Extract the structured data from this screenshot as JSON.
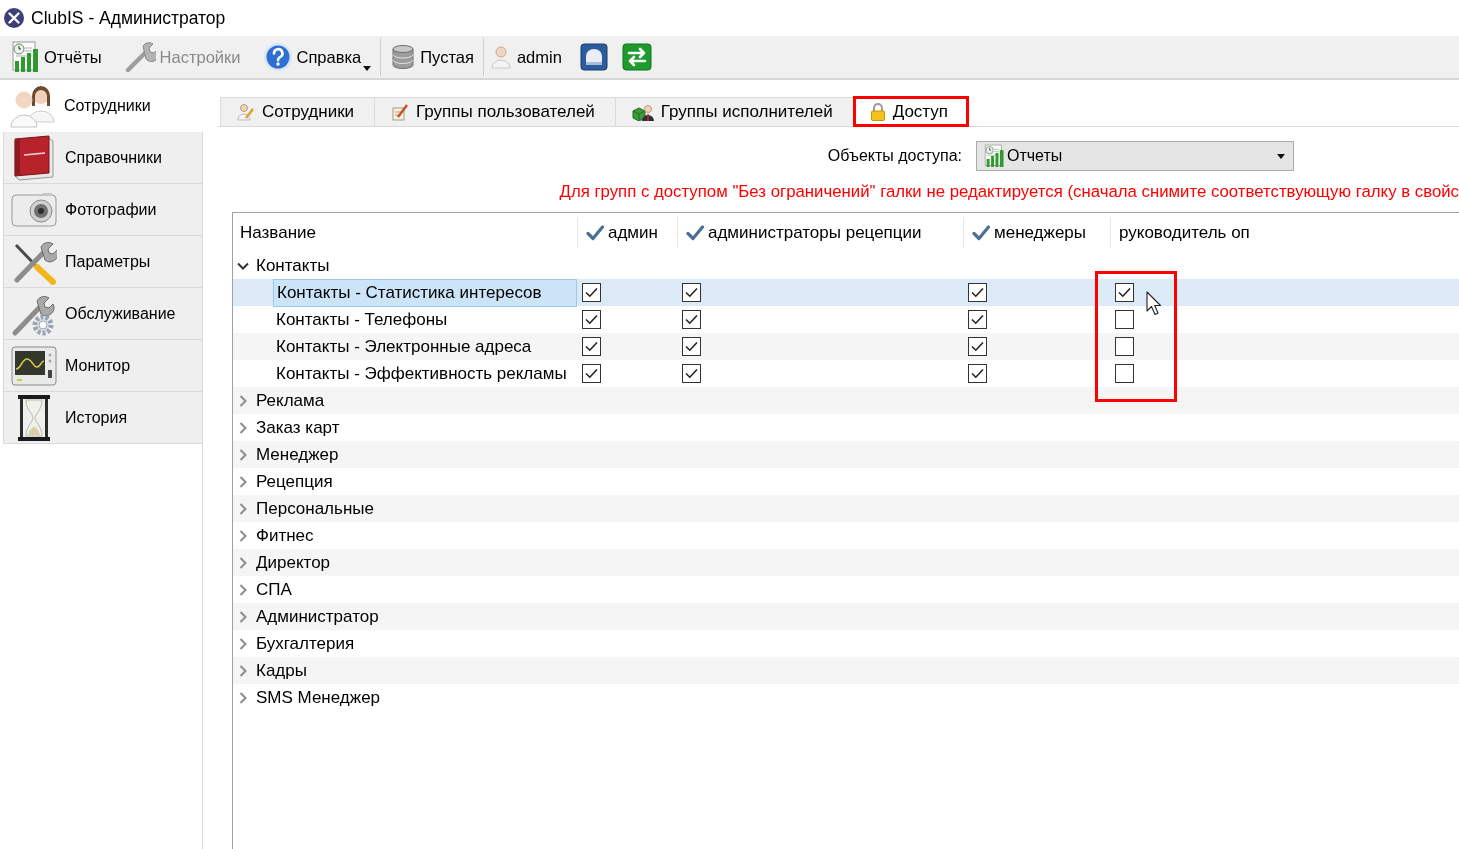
{
  "window": {
    "title": "ClubIS - Администратор"
  },
  "toolbar": {
    "groups": [
      [
        {
          "kind": "button",
          "label": "Отчёты",
          "disabled": false,
          "dropdown": false
        },
        {
          "kind": "button",
          "label": "Настройки",
          "disabled": true,
          "dropdown": false
        },
        {
          "kind": "button",
          "label": "Справка",
          "disabled": false,
          "dropdown": true
        }
      ],
      [
        {
          "kind": "button",
          "label": "Пустая",
          "disabled": false,
          "dropdown": false
        }
      ],
      [
        {
          "kind": "user",
          "label": "admin"
        },
        {
          "kind": "icon_button",
          "disabled": false
        },
        {
          "kind": "icon_button",
          "disabled": false
        }
      ]
    ]
  },
  "sidebar": {
    "items": [
      {
        "label": "Сотрудники",
        "selected": true
      },
      {
        "label": "Справочники",
        "selected": false
      },
      {
        "label": "Фотографии",
        "selected": false
      },
      {
        "label": "Параметры",
        "selected": false
      },
      {
        "label": "Обслуживание",
        "selected": false
      },
      {
        "label": "Монитор",
        "selected": false
      },
      {
        "label": "История",
        "selected": false
      }
    ]
  },
  "tabs": [
    {
      "label": "Сотрудники",
      "selected": false,
      "highlighted": false
    },
    {
      "label": "Группы пользователей",
      "selected": false,
      "highlighted": false
    },
    {
      "label": "Группы исполнителей",
      "selected": false,
      "highlighted": false
    },
    {
      "label": "Доступ",
      "selected": true,
      "highlighted": true
    }
  ],
  "access_objects": {
    "label": "Объекты доступа:",
    "value": "Отчеты"
  },
  "notice": "Для групп с доступом \"Без ограничений\" галки не редактируется (сначала снимите соответствующую галку в свойс",
  "tree": {
    "columns": [
      {
        "label": "Название",
        "checked": false,
        "highlighted": false
      },
      {
        "label": "админ",
        "checked": true,
        "highlighted": false
      },
      {
        "label": "администраторы рецепции",
        "checked": true,
        "highlighted": false
      },
      {
        "label": "менеджеры",
        "checked": true,
        "highlighted": false
      },
      {
        "label": "руководитель оп",
        "checked": false,
        "highlighted": true
      }
    ],
    "rows": [
      {
        "label": "Контакты",
        "expanded": true,
        "selected": false,
        "children": [
          {
            "label": "Контакты - Статистика интересов",
            "selected": true,
            "checks": [
              true,
              true,
              true,
              true
            ]
          },
          {
            "label": "Контакты - Телефоны",
            "selected": false,
            "checks": [
              true,
              true,
              true,
              false
            ]
          },
          {
            "label": "Контакты - Электронные адреса",
            "selected": false,
            "checks": [
              true,
              true,
              true,
              false
            ]
          },
          {
            "label": "Контакты - Эффективность рекламы",
            "selected": false,
            "checks": [
              true,
              true,
              true,
              false
            ]
          }
        ]
      },
      {
        "label": "Реклама",
        "expanded": false,
        "selected": false
      },
      {
        "label": "Заказ карт",
        "expanded": false,
        "selected": false
      },
      {
        "label": "Менеджер",
        "expanded": false,
        "selected": false
      },
      {
        "label": "Рецепция",
        "expanded": false,
        "selected": false
      },
      {
        "label": "Персональные",
        "expanded": false,
        "selected": false
      },
      {
        "label": "Фитнес",
        "expanded": false,
        "selected": false
      },
      {
        "label": "Директор",
        "expanded": false,
        "selected": false
      },
      {
        "label": "СПА",
        "expanded": false,
        "selected": false
      },
      {
        "label": "Администратор",
        "expanded": false,
        "selected": false
      },
      {
        "label": "Бухгалтерия",
        "expanded": false,
        "selected": false
      },
      {
        "label": "Кадры",
        "expanded": false,
        "selected": false
      },
      {
        "label": "SMS Менеджер",
        "expanded": false,
        "selected": false
      }
    ]
  }
}
